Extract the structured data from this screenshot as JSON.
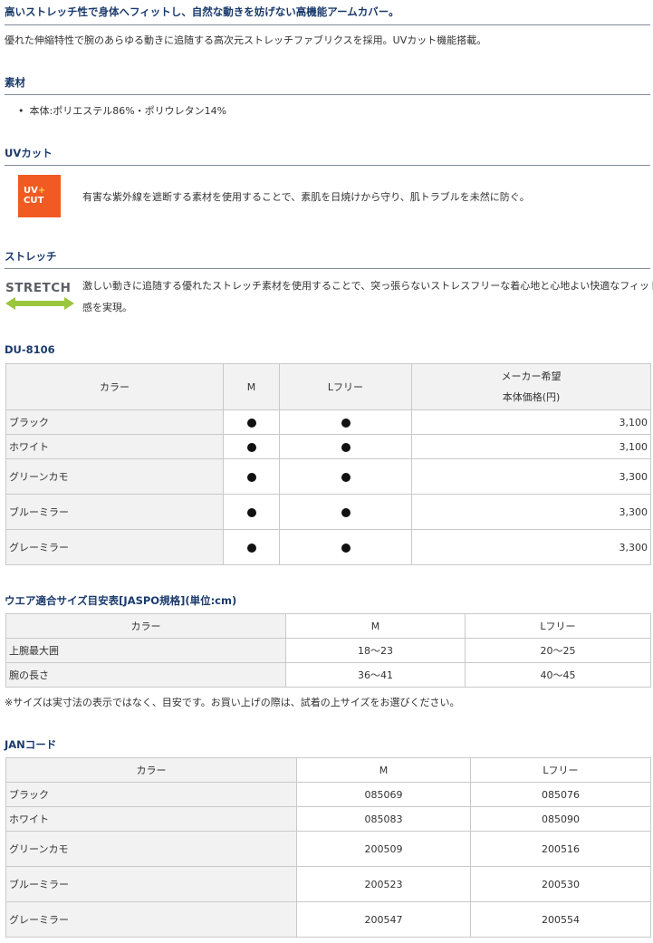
{
  "headline": "高いストレッチ性で身体へフィットし、自然な動きを妨げない高機能アームカバー。",
  "intro": "優れた伸縮特性で腕のあらゆる動きに追随する高次元ストレッチファブリクスを採用。UVカット機能搭載。",
  "material": {
    "heading": "素材",
    "item": "本体:ポリエステル86%・ポリウレタン14%"
  },
  "uvcut": {
    "heading": "UVカット",
    "badge_line1": "UV",
    "badge_plus": "+",
    "badge_line2": "CUT",
    "description": "有害な紫外線を遮断する素材を使用することで、素肌を日焼けから守り、肌トラブルを未然に防ぐ。"
  },
  "stretch": {
    "heading": "ストレッチ",
    "logo_text": "STRETCH",
    "description_line1": "激しい動きに追随する優れたストレッチ素材を使用することで、突っ張らないストレスフリーな着心地と心地よい快適なフィット",
    "description_line2": "感を実現。"
  },
  "product_table": {
    "heading": "DU-8106",
    "headers": {
      "color": "カラー",
      "m": "M",
      "l": "Lフリー",
      "price_line1": "メーカー希望",
      "price_line2": "本体価格(円)"
    },
    "rows": [
      {
        "color": "ブラック",
        "m": true,
        "l": true,
        "price": "3,100"
      },
      {
        "color": "ホワイト",
        "m": true,
        "l": true,
        "price": "3,100"
      },
      {
        "color": "グリーンカモ",
        "m": true,
        "l": true,
        "price": "3,300"
      },
      {
        "color": "ブルーミラー",
        "m": true,
        "l": true,
        "price": "3,300"
      },
      {
        "color": "グレーミラー",
        "m": true,
        "l": true,
        "price": "3,300"
      }
    ]
  },
  "size_table": {
    "heading": "ウエア適合サイズ目安表[JASPO規格](単位:cm)",
    "headers": {
      "label": "カラー",
      "m": "M",
      "l": "Lフリー"
    },
    "rows": [
      {
        "label": "上腕最大囲",
        "m": "18〜23",
        "l": "20〜25"
      },
      {
        "label": "腕の長さ",
        "m": "36〜41",
        "l": "40〜45"
      }
    ],
    "note": "※サイズは実寸法の表示ではなく、目安です。お買い上げの際は、試着の上サイズをお選びください。"
  },
  "jan_table": {
    "heading": "JANコード",
    "headers": {
      "color": "カラー",
      "m": "M",
      "l": "Lフリー"
    },
    "rows": [
      {
        "color": "ブラック",
        "m": "085069",
        "l": "085076"
      },
      {
        "color": "ホワイト",
        "m": "085083",
        "l": "085090"
      },
      {
        "color": "グリーンカモ",
        "m": "200509",
        "l": "200516"
      },
      {
        "color": "ブルーミラー",
        "m": "200523",
        "l": "200530"
      },
      {
        "color": "グレーミラー",
        "m": "200547",
        "l": "200554"
      }
    ]
  },
  "colors": {
    "heading": "#1a3a6b",
    "uv_badge": "#f15a22",
    "stretch_arrow": "#9bc53d",
    "table_header_bg": "#f2f2f2"
  }
}
